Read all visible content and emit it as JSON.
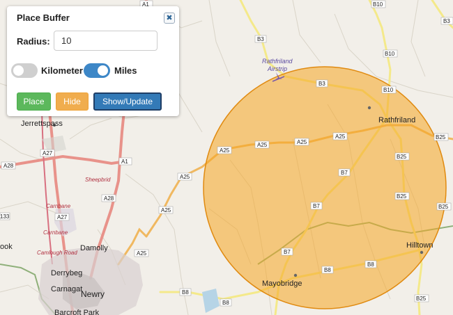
{
  "panel": {
    "title": "Place Buffer",
    "close_icon": "close-icon",
    "radius_label": "Radius:",
    "radius_value": "10",
    "unit_km_label": "Kilometer",
    "unit_km_on": false,
    "unit_mi_label": "Miles",
    "unit_mi_on": true,
    "buttons": {
      "place": "Place",
      "hide": "Hide",
      "show_update": "Show/Update"
    }
  },
  "colors": {
    "buffer_fill": "#f5a623",
    "buffer_stroke": "#e08a10",
    "place_button": "#5cb85c",
    "hide_button": "#f0ad4e",
    "show_button": "#337ab7",
    "toggle_on": "#3d87c7"
  },
  "map": {
    "places": {
      "jerrettspass": "Jerrettspass",
      "rathfriland": "Rathfriland",
      "newry": "Newry",
      "derrybeg": "Derrybeg",
      "carnagat": "Carnagat",
      "damolly": "Damolly",
      "hilltown": "Hilltown",
      "mayobridge": "Mayobridge",
      "barcroft_park": "Barcroft Park",
      "ook": "ook"
    },
    "italic_places": {
      "sheepbridge": "Sheepbrid",
      "carnbane": "Carnbane",
      "carnbane2": "Carnbane",
      "camlough_road": "Camlough Road"
    },
    "airstrip": {
      "line1": "Rathfriland",
      "line2": "Airstrip"
    },
    "roads": {
      "a1_top": "A1",
      "a1": "A1",
      "a27_1": "A27",
      "a27_2": "A27",
      "a28_1": "A28",
      "a28_2": "A28",
      "a25_1": "A25",
      "a25_2": "A25",
      "a25_3": "A25",
      "a25_4": "A25",
      "a25_5": "A25",
      "a25_6": "A25",
      "a25_7": "A25",
      "b3_1": "B3",
      "b3_2": "B3",
      "b10_1": "B10",
      "b10_2": "B10",
      "b10_3": "B10",
      "b7_1": "B7",
      "b7_2": "B7",
      "b7_3": "B7",
      "b8_1": "B8",
      "b8_2": "B8",
      "b8_3": "B8",
      "b8_4": "B8",
      "b25_1": "B25",
      "b25_2": "B25",
      "b25_3": "B25",
      "b25_4": "B25",
      "b25_5": "B25",
      "b3_right": "B3",
      "a133": "133"
    }
  }
}
